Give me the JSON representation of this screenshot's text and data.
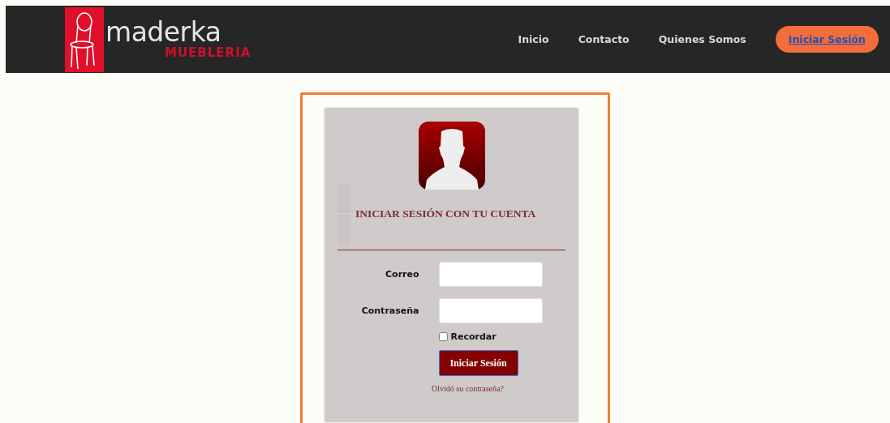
{
  "brand": {
    "name": "maderka",
    "tagline": "MUEBLERIA"
  },
  "nav": [
    {
      "label": "Inicio",
      "kind": "link"
    },
    {
      "label": "Contacto",
      "kind": "link"
    },
    {
      "label": "Quienes Somos",
      "kind": "link"
    },
    {
      "label": "Iniciar Sesión",
      "kind": "cta"
    }
  ],
  "login": {
    "title": "INICIAR SESIÓN CON TU CUENTA",
    "fields": [
      {
        "label": "Correo"
      },
      {
        "label": "Contraseña"
      }
    ],
    "remember": {
      "label": "Recordar",
      "checked": false
    },
    "submit": "Iniciar Sesión",
    "forgot": "Olvidó su contraseña?"
  }
}
